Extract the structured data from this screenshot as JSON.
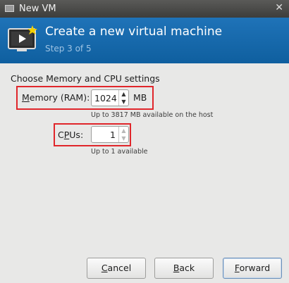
{
  "window": {
    "title": "New VM",
    "close_glyph": "✕"
  },
  "header": {
    "title": "Create a new virtual machine",
    "step": "Step 3 of 5",
    "icon": "vm-wizard-icon",
    "accent_color": "#1a6aae"
  },
  "settings": {
    "section_title": "Choose Memory and CPU settings",
    "memory": {
      "label_mnemonic": "M",
      "label_rest": "emory (RAM):",
      "value": "1024",
      "unit": "MB",
      "hint": "Up to 3817 MB available on the host"
    },
    "cpus": {
      "label_prefix": "C",
      "label_mnemonic": "P",
      "label_rest": "Us:",
      "value": "1",
      "hint": "Up to 1 available"
    },
    "highlight_color": "#e0262b"
  },
  "buttons": {
    "cancel": {
      "mnemonic": "C",
      "rest": "ancel"
    },
    "back": {
      "mnemonic": "B",
      "rest": "ack"
    },
    "forward": {
      "mnemonic": "F",
      "rest": "orward"
    }
  }
}
